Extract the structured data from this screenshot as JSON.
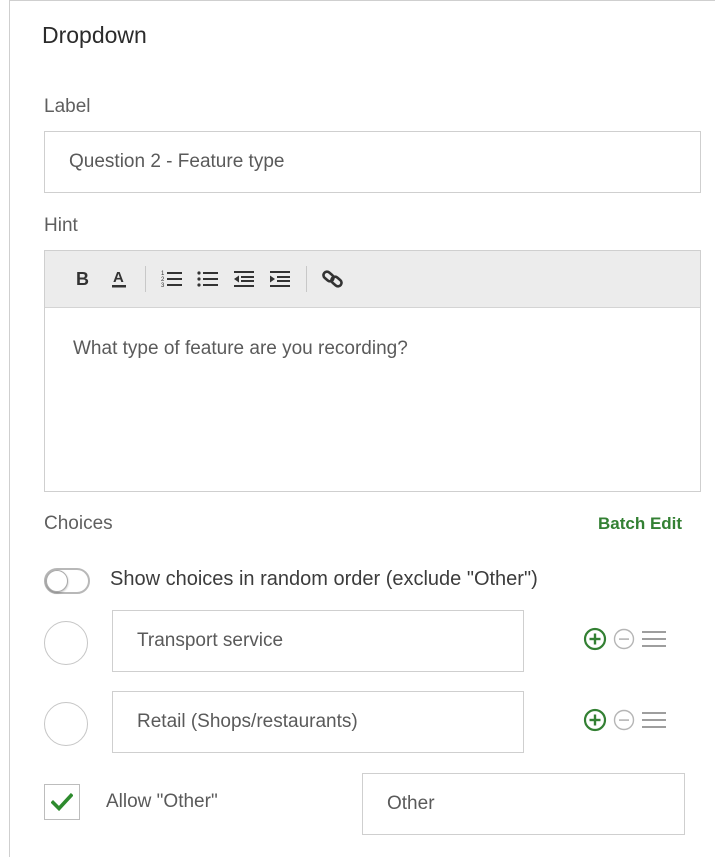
{
  "panel": {
    "title": "Dropdown"
  },
  "label_field": {
    "label": "Label",
    "value": "Question 2 - Feature type"
  },
  "hint_field": {
    "label": "Hint",
    "toolbar": [
      "bold-icon",
      "font-color-icon",
      "numbered-list-icon",
      "bulleted-list-icon",
      "outdent-icon",
      "indent-icon",
      "link-icon"
    ],
    "value": "What type of feature are you recording?"
  },
  "choices": {
    "label": "Choices",
    "batch_edit": "Batch Edit",
    "random_order_label": "Show choices in random order (exclude \"Other\")",
    "random_order_on": false,
    "items": [
      {
        "value": "Transport service"
      },
      {
        "value": "Retail (Shops/restaurants)"
      }
    ]
  },
  "other": {
    "label": "Allow \"Other\"",
    "checked": true,
    "value": "Other"
  },
  "colors": {
    "accent_green": "#338033",
    "border": "#cfcfcf",
    "toolbar_bg": "#ececec"
  }
}
